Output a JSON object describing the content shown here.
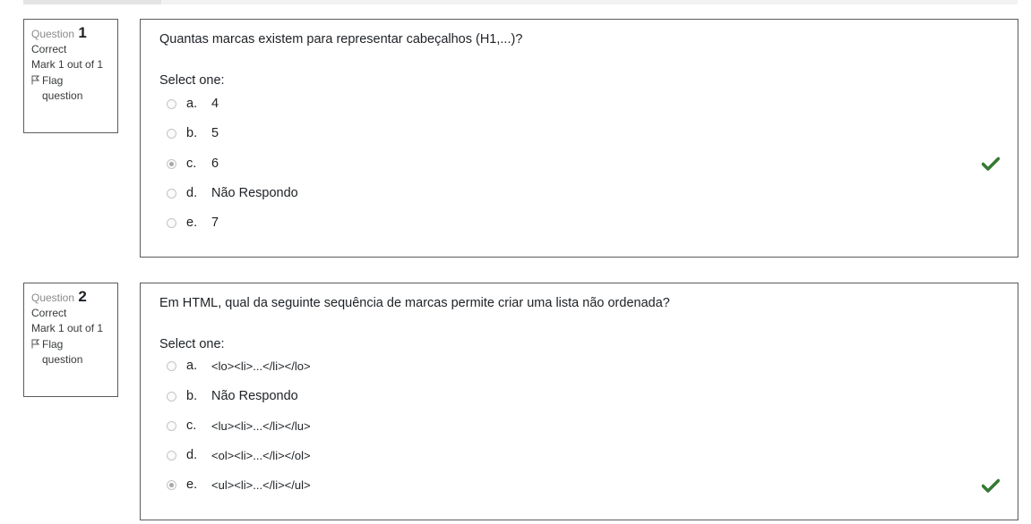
{
  "questions": [
    {
      "label": "Question",
      "number": "1",
      "state": "Correct",
      "mark": "Mark 1 out of 1",
      "flag_line1": "Flag",
      "flag_line2": "question",
      "text": "Quantas marcas existem para representar cabeçalhos (H1,...)?",
      "prompt": "Select one:",
      "options": [
        {
          "letter": "a.",
          "text": "4",
          "checked": false
        },
        {
          "letter": "b.",
          "text": "5",
          "checked": false
        },
        {
          "letter": "c.",
          "text": "6",
          "checked": true
        },
        {
          "letter": "d.",
          "text": "Não Respondo",
          "checked": false
        },
        {
          "letter": "e.",
          "text": "7",
          "checked": false
        }
      ]
    },
    {
      "label": "Question",
      "number": "2",
      "state": "Correct",
      "mark": "Mark 1 out of 1",
      "flag_line1": "Flag",
      "flag_line2": "question",
      "text": "Em HTML, qual da seguinte sequência de marcas permite criar uma lista não ordenada?",
      "prompt": "Select one:",
      "options": [
        {
          "letter": "a.",
          "text": "<lo><li>...</li></lo>",
          "checked": false
        },
        {
          "letter": "b.",
          "text": "Não Respondo",
          "checked": false
        },
        {
          "letter": "c.",
          "text": "<lu><li>...</li></lu>",
          "checked": false
        },
        {
          "letter": "d.",
          "text": "<ol><li>...</li></ol>",
          "checked": false
        },
        {
          "letter": "e.",
          "text": "<ul><li>...</li></ul>",
          "checked": true
        }
      ]
    }
  ],
  "colors": {
    "correct_tick": "#357a32",
    "border": "#5b5b5b"
  },
  "icons": {
    "flag": "flag-icon",
    "correct": "check-icon"
  }
}
